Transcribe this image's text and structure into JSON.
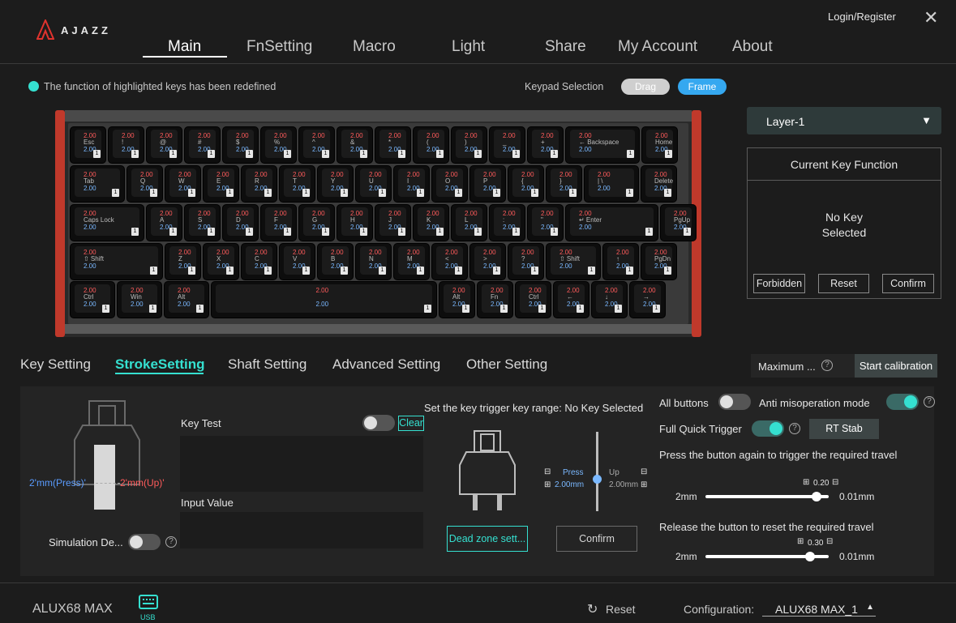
{
  "app": {
    "brand": "AJAZZ",
    "login": "Login/Register",
    "close_icon": "close-icon"
  },
  "nav": {
    "items": [
      {
        "label": "Main",
        "active": true
      },
      {
        "label": "FnSetting"
      },
      {
        "label": "Macro"
      },
      {
        "label": "Light"
      },
      {
        "label": "Share"
      },
      {
        "label": "My Account"
      },
      {
        "label": "About"
      }
    ]
  },
  "toolbar": {
    "hint": "The function of highlighted keys has been redefined",
    "keypad_label": "Keypad Selection",
    "drag": "Drag",
    "frame": "Frame"
  },
  "keyboard": {
    "press": "2.00",
    "release": "2.00",
    "layer_num": "1",
    "rows": [
      [
        {
          "l": "Esc"
        },
        {
          "l": "!"
        },
        {
          "l": "@"
        },
        {
          "l": "#"
        },
        {
          "l": "$"
        },
        {
          "l": "%"
        },
        {
          "l": "^"
        },
        {
          "l": "&"
        },
        {
          "l": "*"
        },
        {
          "l": "("
        },
        {
          "l": ")"
        },
        {
          "l": "_"
        },
        {
          "l": "+"
        },
        {
          "l": "← Backspace"
        },
        {
          "l": "Home"
        }
      ],
      [
        {
          "l": "Tab"
        },
        {
          "l": "Q"
        },
        {
          "l": "W"
        },
        {
          "l": "E"
        },
        {
          "l": "R"
        },
        {
          "l": "T"
        },
        {
          "l": "Y"
        },
        {
          "l": "U"
        },
        {
          "l": "I"
        },
        {
          "l": "O"
        },
        {
          "l": "P"
        },
        {
          "l": "{"
        },
        {
          "l": "}"
        },
        {
          "l": "| \\"
        },
        {
          "l": "Delete"
        }
      ],
      [
        {
          "l": "Caps Lock"
        },
        {
          "l": "A"
        },
        {
          "l": "S"
        },
        {
          "l": "D"
        },
        {
          "l": "F"
        },
        {
          "l": "G"
        },
        {
          "l": "H"
        },
        {
          "l": "J"
        },
        {
          "l": "K"
        },
        {
          "l": "L"
        },
        {
          "l": ":"
        },
        {
          "l": "\""
        },
        {
          "l": "↵ Enter"
        },
        {
          "l": "PgUp"
        }
      ],
      [
        {
          "l": "⇧ Shift"
        },
        {
          "l": "Z"
        },
        {
          "l": "X"
        },
        {
          "l": "C"
        },
        {
          "l": "V"
        },
        {
          "l": "B"
        },
        {
          "l": "N"
        },
        {
          "l": "M"
        },
        {
          "l": "<"
        },
        {
          "l": ">"
        },
        {
          "l": "?"
        },
        {
          "l": "⇧ Shift"
        },
        {
          "l": "↑"
        },
        {
          "l": "PgDn"
        }
      ],
      [
        {
          "l": "Ctrl"
        },
        {
          "l": "Win"
        },
        {
          "l": "Alt"
        },
        {
          "l": ""
        },
        {
          "l": "Alt"
        },
        {
          "l": "Fn"
        },
        {
          "l": "Ctrl"
        },
        {
          "l": "←"
        },
        {
          "l": "↓"
        },
        {
          "l": "→"
        }
      ]
    ]
  },
  "side": {
    "layer": "Layer-1",
    "ckf_title": "Current Key Function",
    "ckf_none": "No Key Selected",
    "forbidden": "Forbidden",
    "reset": "Reset",
    "confirm": "Confirm"
  },
  "tabs": [
    {
      "label": "Key Setting"
    },
    {
      "label": "StrokeSetting",
      "active": true
    },
    {
      "label": "Shaft Setting"
    },
    {
      "label": "Advanced Setting"
    },
    {
      "label": "Other Setting"
    }
  ],
  "calibration": {
    "maximum": "Maximum ...",
    "start": "Start calibration"
  },
  "stroke": {
    "press_label": "2'mm(Press)'",
    "up_label": "2'mm(Up)'",
    "simulation": "Simulation De...",
    "key_test": "Key Test",
    "clear": "Clear",
    "input_value": "Input Value",
    "trigger_range": "Set the key trigger key range: No Key Selected",
    "press": "Press",
    "press_val": "2.00mm",
    "up": "Up",
    "up_val": "2.00mm",
    "dead_zone": "Dead zone sett...",
    "confirm": "Confirm",
    "press_slider_fraction": 0.0,
    "all_buttons": "All buttons",
    "anti_mis": "Anti misoperation mode",
    "full_quick": "Full Quick Trigger",
    "rt_stab": "RT Stab",
    "press_again": "Press the button again to trigger the required travel",
    "trigger_val": "0.20",
    "trigger_fraction": 0.9,
    "release_reset": "Release the button to reset the required travel",
    "release_val": "0.30",
    "release_fraction": 0.85,
    "min": "2mm",
    "max": "0.01mm"
  },
  "footer": {
    "device": "ALUX68 MAX",
    "usb": "USB",
    "reset": "Reset",
    "configuration": "Configuration:",
    "config_value": "ALUX68 MAX_1"
  }
}
